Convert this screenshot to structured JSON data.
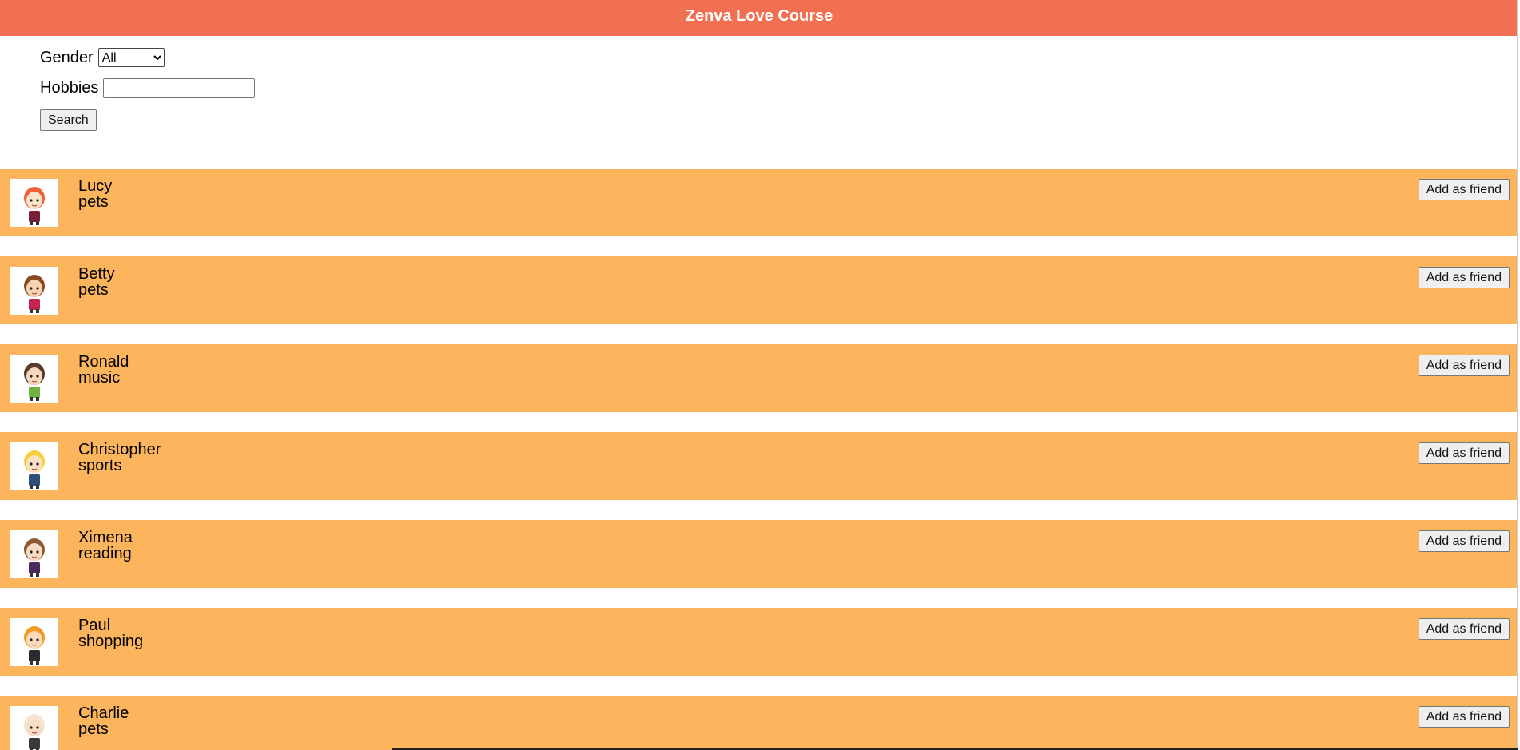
{
  "app": {
    "title": "Zenva Love Course",
    "header_color": "#f27052",
    "row_color": "#fcb55d"
  },
  "filters": {
    "gender_label": "Gender",
    "gender_options": [
      "All"
    ],
    "gender_selected": "All",
    "hobbies_label": "Hobbies",
    "hobbies_value": "",
    "search_label": "Search"
  },
  "people": [
    {
      "name": "Lucy",
      "hobby": "pets",
      "hair": "#f2603a",
      "skin": "#fde3c8",
      "outfit": "#7a1f3a",
      "accent": "#f2603a",
      "button": "Add as friend"
    },
    {
      "name": "Betty",
      "hobby": "pets",
      "hair": "#8a4a22",
      "skin": "#f7d3b0",
      "outfit": "#c4244d",
      "accent": "#d81f3f",
      "button": "Add as friend"
    },
    {
      "name": "Ronald",
      "hobby": "music",
      "hair": "#5a3a2c",
      "skin": "#f7d8bd",
      "outfit": "#6eb33f",
      "accent": "#5a3a2c",
      "button": "Add as friend"
    },
    {
      "name": "Christopher",
      "hobby": "sports",
      "hair": "#f5d13c",
      "skin": "#fbe0c4",
      "outfit": "#2f4f7a",
      "accent": "#f5d13c",
      "button": "Add as friend"
    },
    {
      "name": "Ximena",
      "hobby": "reading",
      "hair": "#8d5a34",
      "skin": "#f8dcc4",
      "outfit": "#4a2a5e",
      "accent": "#8d5a34",
      "button": "Add as friend"
    },
    {
      "name": "Paul",
      "hobby": "shopping",
      "hair": "#f39a1f",
      "skin": "#fbd9bf",
      "outfit": "#2b2b2b",
      "accent": "#f39a1f",
      "button": "Add as friend"
    },
    {
      "name": "Charlie",
      "hobby": "pets",
      "hair": "#f5e6d3",
      "skin": "#f6ddc5",
      "outfit": "#3a3a3a",
      "accent": "#e9d2b8",
      "button": "Add as friend"
    }
  ]
}
